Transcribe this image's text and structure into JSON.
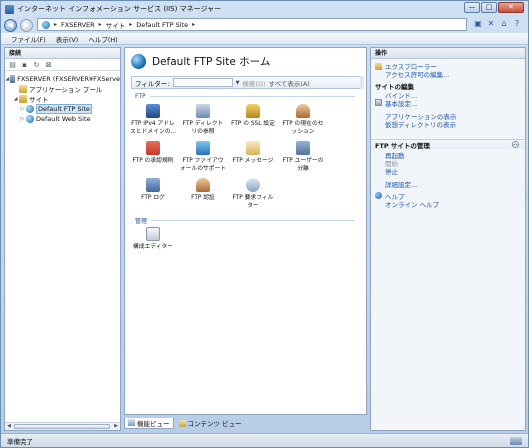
{
  "window": {
    "title": "インターネット インフォメーション サービス (IIS) マネージャー",
    "buttons": {
      "minimize": "—",
      "maximize": "□",
      "close": "✕"
    }
  },
  "address": {
    "segments": [
      "FXSERVER",
      "サイト",
      "Default FTP Site"
    ],
    "separator": "▸"
  },
  "menu": {
    "file": "ファイル(F)",
    "view": "表示(V)",
    "help": "ヘルプ(H)"
  },
  "connections": {
    "header": "接続",
    "tree": [
      {
        "label": "FXSERVER (FXSERVER¥FXServe"
      },
      {
        "label": "アプリケーション プール"
      },
      {
        "label": "サイト"
      },
      {
        "label": "Default FTP Site"
      },
      {
        "label": "Default Web Site"
      }
    ]
  },
  "main": {
    "title": "Default FTP Site ホーム",
    "filter_label": "フィルター:",
    "go_label": "検索(G)",
    "show_all_label": "すべて表示(A)",
    "group_ftp": "FTP",
    "group_manage": "管理",
    "features": [
      {
        "line1": "FTP IPv4 アドレ",
        "line2": "スとドメインの..."
      },
      {
        "line1": "FTP ディレクト",
        "line2": "リの参照"
      },
      {
        "line1": "FTP の SSL 設定",
        "line2": ""
      },
      {
        "line1": "FTP の現在のセ",
        "line2": "ッション"
      },
      {
        "line1": "FTP の承認規則",
        "line2": ""
      },
      {
        "line1": "FTP ファイアウ",
        "line2": "ォールのサポート"
      },
      {
        "line1": "FTP メッセージ",
        "line2": ""
      },
      {
        "line1": "FTP ユーザーの",
        "line2": "分離"
      },
      {
        "line1": "FTP ログ",
        "line2": ""
      },
      {
        "line1": "FTP 認証",
        "line2": ""
      },
      {
        "line1": "FTP 要求フィル",
        "line2": "ター"
      }
    ],
    "manage_features": [
      {
        "line1": "構成エディター",
        "line2": ""
      }
    ],
    "tabs": {
      "features": "機能ビュー",
      "content": "コンテンツ ビュー"
    }
  },
  "actions": {
    "header": "操作",
    "explore": "エクスプローラー",
    "edit_permissions": "アクセス許可の編集...",
    "site_edit_header": "サイトの編集",
    "bindings": "バインド...",
    "basic_settings": "基本設定...",
    "view_apps": "アプリケーションの表示",
    "view_vdirs": "仮想ディレクトリの表示",
    "ftp_manage_header": "FTP サイトの管理",
    "restart": "再起動",
    "start": "開始",
    "stop": "停止",
    "advanced": "詳細設定...",
    "help": "ヘルプ",
    "online_help": "オンライン ヘルプ"
  },
  "status": {
    "text": "準備完了"
  }
}
